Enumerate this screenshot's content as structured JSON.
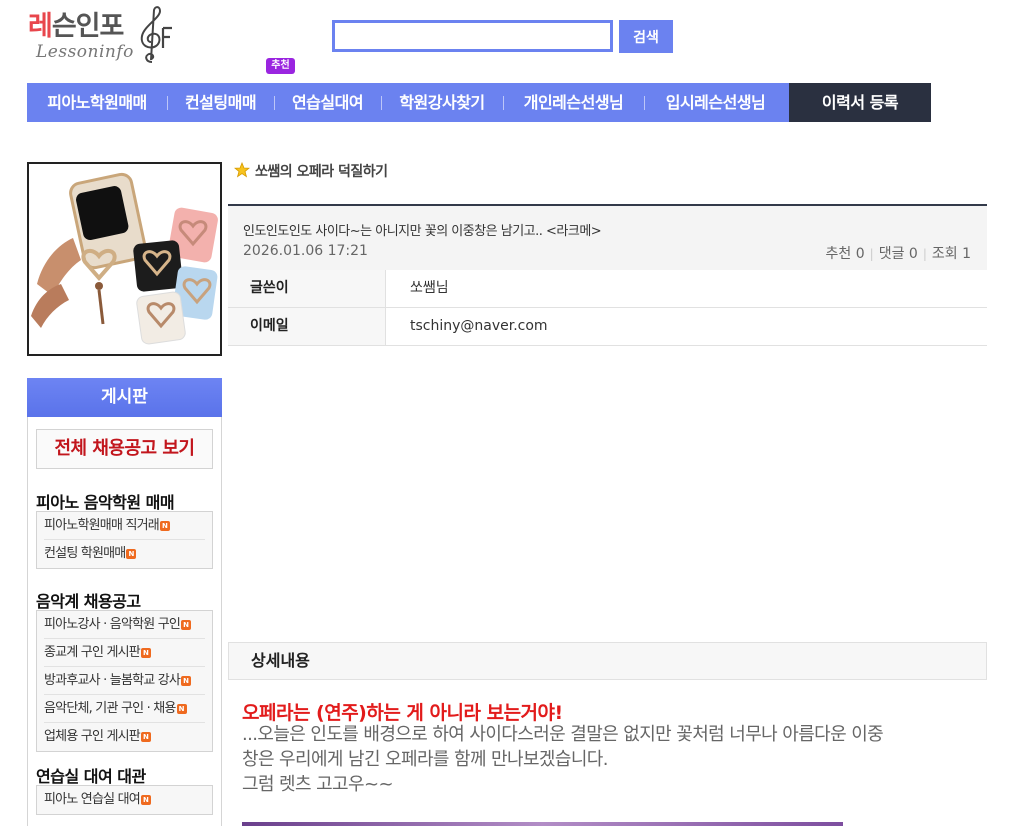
{
  "header": {
    "logo_kor_prefix": "레",
    "logo_kor_rest": "슨인포",
    "logo_eng": "Lessoninfo",
    "search_placeholder": "",
    "search_button": "검색",
    "recommend_badge": "추천"
  },
  "nav": {
    "items": [
      "피아노학원매매",
      "컨설팅매매",
      "연습실대여",
      "학원강사찾기",
      "개인레슨선생님",
      "입시레슨선생님"
    ],
    "resume_button": "이력서 등록"
  },
  "sidebar": {
    "board_title": "게시판",
    "all_jobs_button": "전체 채용공고 보기",
    "sections": [
      {
        "title": "피아노 음악학원 매매",
        "items": [
          "피아노학원매매 직거래",
          "컨설팅 학원매매"
        ]
      },
      {
        "title": "음악계 채용공고",
        "items": [
          "피아노강사 · 음악학원 구인",
          "종교계 구인 게시판",
          "방과후교사 · 늘봄학교 강사",
          "음악단체, 기관 구인 · 채용",
          "업체용 구인 게시판"
        ]
      },
      {
        "title": "연습실 대여 대관",
        "items": [
          "피아노 연습실 대여"
        ]
      }
    ],
    "new_badge": "N"
  },
  "post": {
    "board_name": "쏘쌤의 오페라 덕질하기",
    "title": "인도인도인도 사이다~는 아니지만 꽃의 이중창은 남기고.. <라크메>",
    "date": "2026.01.06 17:21",
    "recommend_label": "추천 0",
    "comment_label": "댓글 0",
    "view_label": "조회 1",
    "author_label": "글쓴이",
    "author_value": "쏘쌤님",
    "email_label": "이메일",
    "email_value": "tschiny@naver.com"
  },
  "detail": {
    "heading": "상세내용",
    "headline": "오페라는 (연주)하는 게 아니라 보는거야!",
    "line1": "...오늘은 인도를 배경으로 하여 사이다스러운 결말은 없지만 꽃처럼 너무나 아름다운 이중",
    "line2": "창은 우리에게 남긴 오페라를 함께 만나보겠습니다.",
    "line3": "그럼 렛츠 고고우~~"
  },
  "colors": {
    "accent_blue": "#6b82f0",
    "dark_navy": "#2a3040",
    "headline_red": "#e21b1b",
    "badge_purple": "#9a25e0",
    "new_orange": "#ef6a1f"
  }
}
